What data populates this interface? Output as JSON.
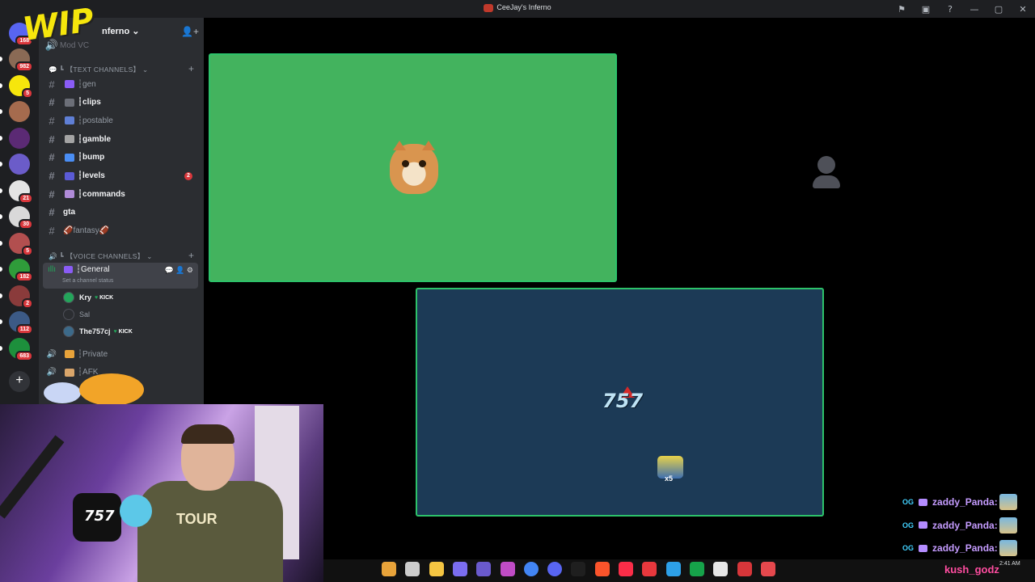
{
  "window": {
    "title": "CeeJay's Inferno"
  },
  "titlebar_icons": [
    "inbox-icon",
    "monitor-icon",
    "help-icon",
    "minimize-icon",
    "maximize-icon",
    "close-icon"
  ],
  "titlebar_glyphs": [
    "⚑",
    "▣",
    "?",
    "—",
    "▢",
    "✕"
  ],
  "guild": {
    "name": "nferno",
    "partial_channel": "Mod VC"
  },
  "servers": [
    {
      "name": "server-1",
      "color": "#8a6a55",
      "badge": "982"
    },
    {
      "name": "server-wip",
      "color": "#f6e60c",
      "badge": "5"
    },
    {
      "name": "server-3",
      "color": "#a56b4e",
      "badge": ""
    },
    {
      "name": "server-4",
      "color": "#5b2a74",
      "badge": ""
    },
    {
      "name": "server-andii",
      "color": "#6b5cc9",
      "badge": ""
    },
    {
      "name": "server-6",
      "color": "#e4e4e4",
      "badge": "21"
    },
    {
      "name": "server-7",
      "color": "#d9d9d9",
      "badge": "30"
    },
    {
      "name": "server-8",
      "color": "#b24f4f",
      "badge": "5"
    },
    {
      "name": "server-9",
      "color": "#2f9c3a",
      "badge": "182"
    },
    {
      "name": "server-10",
      "color": "#8a3b3b",
      "badge": "2"
    },
    {
      "name": "server-11",
      "color": "#3c5a86",
      "badge": "112"
    },
    {
      "name": "server-12",
      "color": "#1d8f3c",
      "badge": "683"
    }
  ],
  "top_badge": "168",
  "text_category": "【TEXT CHANNELS】",
  "voice_category": "【VOICE CHANNELS】",
  "text_channels": [
    {
      "label": "┆gen",
      "unread": false,
      "color": "#8a5cf6",
      "mention": ""
    },
    {
      "label": "┆clips",
      "unread": true,
      "color": "#6c6f78",
      "mention": ""
    },
    {
      "label": "┆postable",
      "unread": false,
      "color": "#5f7fd6",
      "mention": ""
    },
    {
      "label": "┆gamble",
      "unread": true,
      "color": "#a4a4a4",
      "mention": ""
    },
    {
      "label": "┆bump",
      "unread": true,
      "color": "#4a8ef5",
      "mention": ""
    },
    {
      "label": "┆levels",
      "unread": true,
      "color": "#5b5bd6",
      "mention": "2"
    },
    {
      "label": "┆commands",
      "unread": true,
      "color": "#b08bd8",
      "mention": ""
    },
    {
      "label": "gta",
      "unread": true,
      "color": "",
      "mention": ""
    },
    {
      "label": "🏈fantasy🏈",
      "unread": false,
      "color": "",
      "mention": ""
    }
  ],
  "voice_channel": {
    "label": "┆General",
    "status": "Set a channel status"
  },
  "voice_users": [
    {
      "name": "Kry",
      "kick": "KICK",
      "color": "#23a55a"
    },
    {
      "name": "Sal",
      "kick": "",
      "color": "#2b2d31"
    },
    {
      "name": "The757cj",
      "kick": "KICK",
      "color": "#3c6a8a"
    }
  ],
  "other_voice": [
    {
      "label": "┆Private"
    },
    {
      "label": "┆AFK"
    }
  ],
  "stage": {
    "blue_tile_badge": "x5"
  },
  "overlay": {
    "wip_logo": "WIP",
    "shirt_text": "TOUR",
    "mic_logo": "757",
    "blue_logo": "757"
  },
  "chat": [
    {
      "tag": "OG",
      "user": "zaddy_Panda:"
    },
    {
      "tag": "OG",
      "user": "zaddy_Panda:"
    },
    {
      "tag": "OG",
      "user": "zaddy_Panda:"
    }
  ],
  "bottom_user": "kush_godz",
  "clock": {
    "time": "2:41 AM"
  },
  "taskbar_apps": [
    "#e8a33a",
    "#ccc",
    "#f4c542",
    "#7b6df0",
    "#6a5acd",
    "#c04cc6",
    "#4285f4",
    "#5865f2",
    "#1f1f1f",
    "#fb542b",
    "#fa2d48",
    "#e8383d",
    "#2da0e8",
    "#16a34a",
    "#e6e6e6",
    "#d7363a",
    "#e5484d"
  ]
}
